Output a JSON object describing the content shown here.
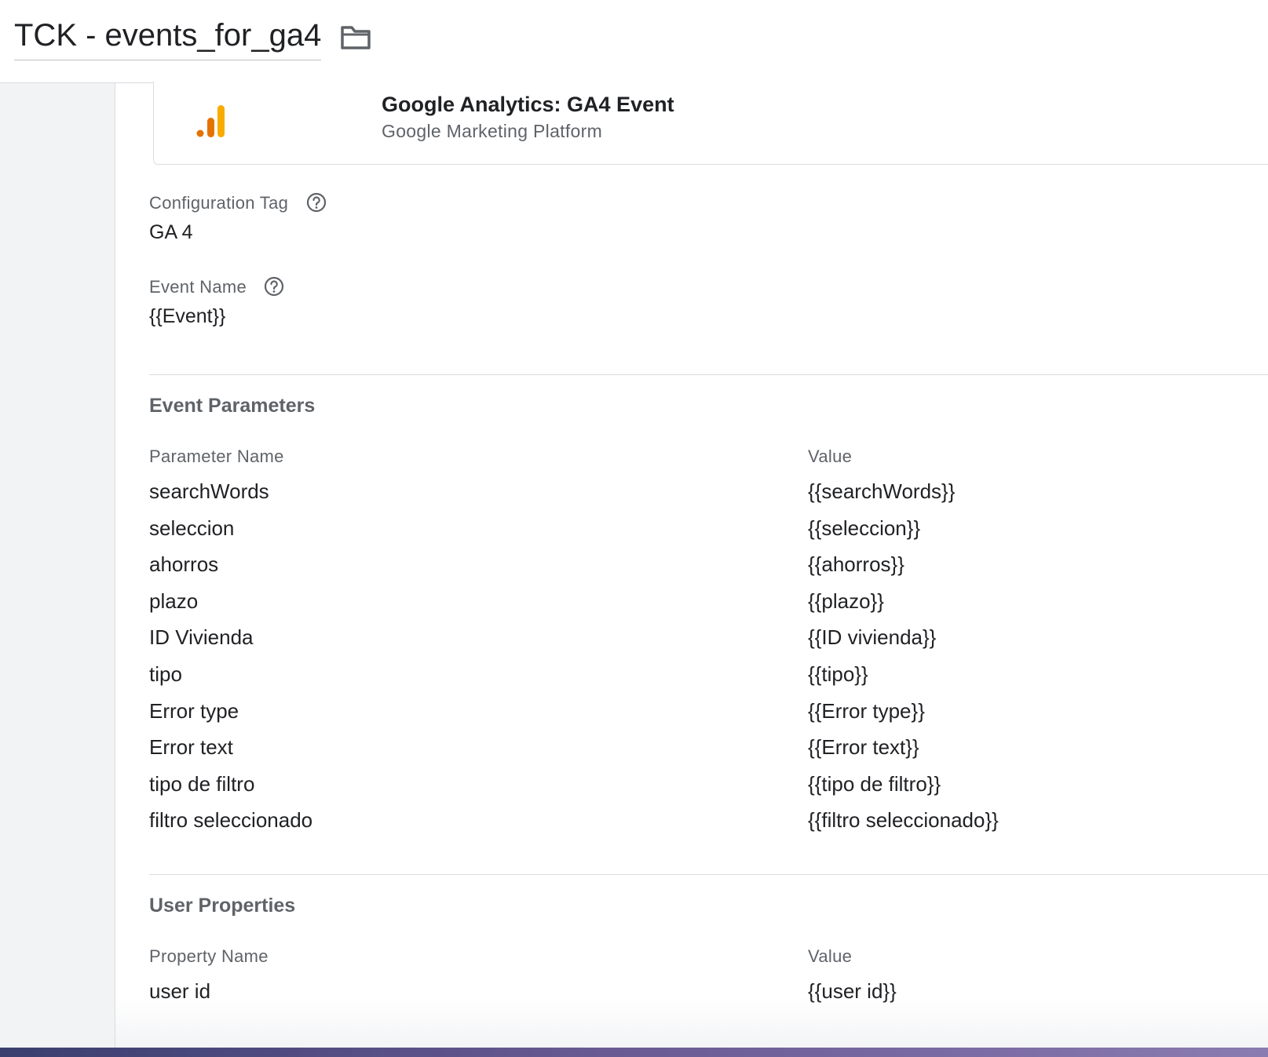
{
  "header": {
    "title": "TCK - events_for_ga4",
    "folder_icon": "folder-icon"
  },
  "tag_type": {
    "title": "Google Analytics: GA4 Event",
    "subtitle": "Google Marketing Platform",
    "logo_icon": "google-analytics-logo-icon",
    "logo_colors": [
      "#e37400",
      "#f9ab00"
    ]
  },
  "configuration_tag": {
    "label": "Configuration Tag",
    "value": "GA 4",
    "help_icon": "help-icon"
  },
  "event_name": {
    "label": "Event Name",
    "value": "{{Event}}",
    "help_icon": "help-icon"
  },
  "event_parameters": {
    "title": "Event Parameters",
    "columns": [
      "Parameter Name",
      "Value"
    ],
    "rows": [
      {
        "name": "searchWords",
        "value": "{{searchWords}}"
      },
      {
        "name": "seleccion",
        "value": "{{seleccion}}"
      },
      {
        "name": "ahorros",
        "value": "{{ahorros}}"
      },
      {
        "name": "plazo",
        "value": "{{plazo}}"
      },
      {
        "name": "ID Vivienda",
        "value": "{{ID vivienda}}"
      },
      {
        "name": "tipo",
        "value": "{{tipo}}"
      },
      {
        "name": "Error type",
        "value": "{{Error type}}"
      },
      {
        "name": "Error text",
        "value": "{{Error text}}"
      },
      {
        "name": "tipo de filtro",
        "value": "{{tipo de filtro}}"
      },
      {
        "name": "filtro seleccionado",
        "value": "{{filtro seleccionado}}"
      }
    ]
  },
  "user_properties": {
    "title": "User Properties",
    "columns": [
      "Property Name",
      "Value"
    ],
    "rows": [
      {
        "name": "user id",
        "value": "{{user id}}"
      }
    ]
  }
}
